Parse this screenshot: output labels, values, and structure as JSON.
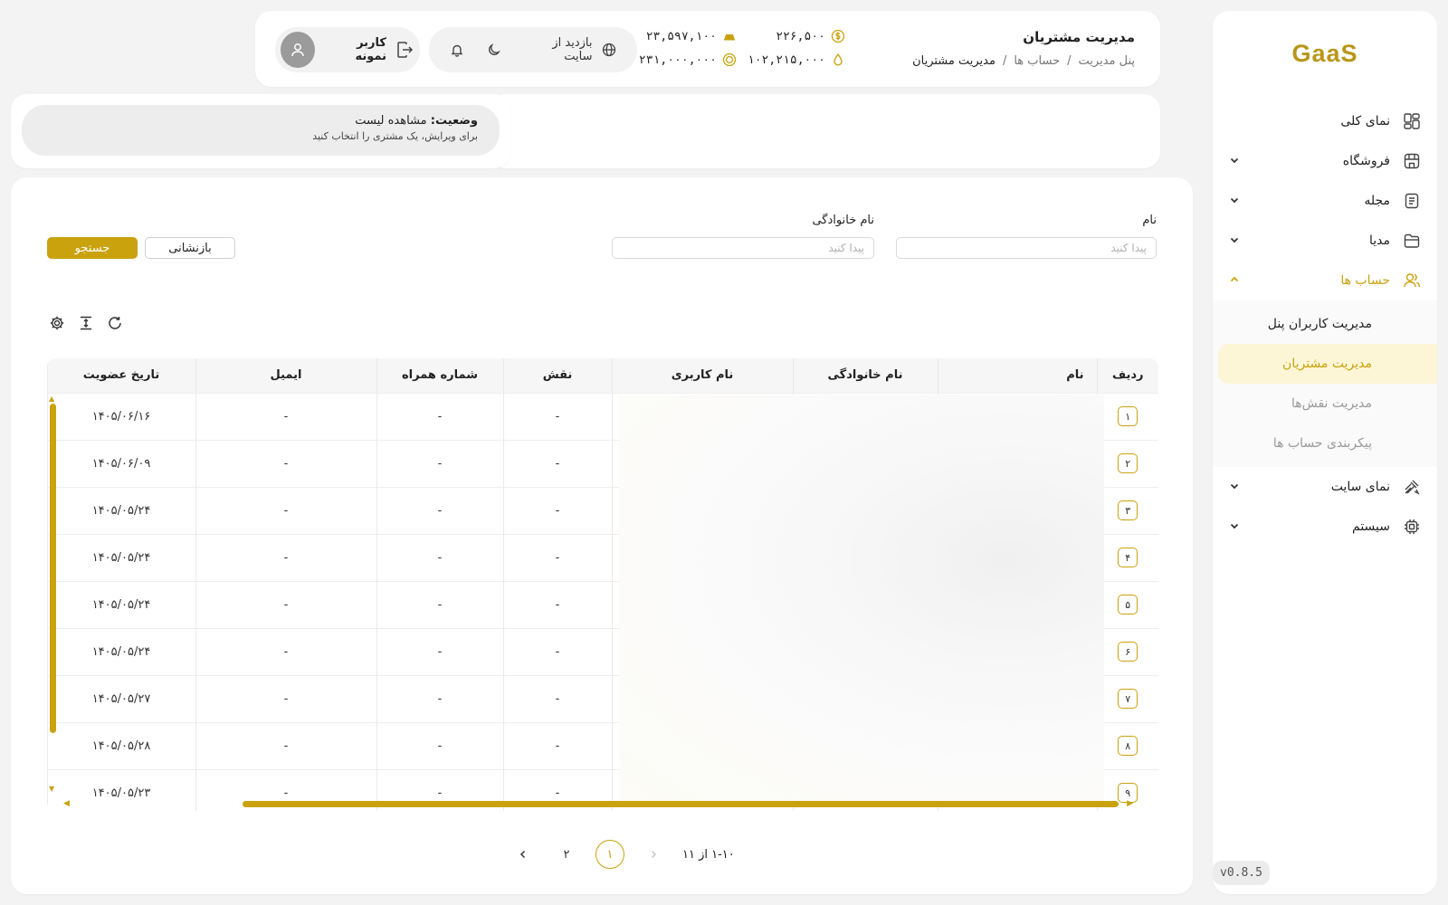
{
  "sidebar": {
    "logo": "GaaS",
    "items": [
      {
        "label": "نمای کلی",
        "icon": "dashboard-grid-icon"
      },
      {
        "label": "فروشگاه",
        "icon": "store-icon"
      },
      {
        "label": "مجله",
        "icon": "document-icon"
      },
      {
        "label": "مدیا",
        "icon": "folder-icon"
      },
      {
        "label": "حساب ها",
        "icon": "users-icon"
      }
    ],
    "submenu": [
      {
        "label": "مدیریت کاربران پنل"
      },
      {
        "label": "مدیریت مشتریان"
      },
      {
        "label": "مدیریت نقش‌ها"
      },
      {
        "label": "پیکربندی حساب ها"
      }
    ],
    "items_after": [
      {
        "label": "نمای سایت",
        "icon": "palette-icon"
      },
      {
        "label": "سیستم",
        "icon": "cpu-icon"
      }
    ],
    "version": "v0.8.5"
  },
  "header": {
    "title": "مدیریت مشتریان",
    "breadcrumb": [
      "پنل مدیریت",
      "/",
      "حساب ها",
      "/",
      "مدیریت مشتریان"
    ],
    "stats": {
      "dollar": "۲۲۶,۵۰۰",
      "gold": "۲۳,۵۹۷,۱۰۰",
      "drop": "۱۰۲,۲۱۵,۰۰۰",
      "coin": "۲۳۱,۰۰۰,۰۰۰"
    },
    "visit_site": "بازدید از سایت",
    "user_name": "کاربر نمونه"
  },
  "status": {
    "label": "وضعیت:",
    "value": "مشاهده لیست",
    "hint": "برای ویرایش، یک مشتری را انتخاب کنید"
  },
  "filters": {
    "first_name_label": "نام",
    "last_name_label": "نام خانوادگی",
    "placeholder": "پیدا کنید",
    "reset": "بازنشانی",
    "search": "جستجو"
  },
  "table": {
    "columns": [
      "ردیف",
      "نام",
      "نام خانوادگی",
      "نام کاربری",
      "نقش",
      "شماره همراه",
      "ایمیل",
      "تاریخ عضویت"
    ],
    "rows": [
      {
        "n": "۱",
        "role": "-",
        "phone": "-",
        "email": "-",
        "date": "۱۴۰۵/۰۶/۱۶"
      },
      {
        "n": "۲",
        "role": "-",
        "phone": "-",
        "email": "-",
        "date": "۱۴۰۵/۰۶/۰۹"
      },
      {
        "n": "۳",
        "role": "-",
        "phone": "-",
        "email": "-",
        "date": "۱۴۰۵/۰۵/۲۴"
      },
      {
        "n": "۴",
        "role": "-",
        "phone": "-",
        "email": "-",
        "date": "۱۴۰۵/۰۵/۲۴"
      },
      {
        "n": "۵",
        "role": "-",
        "phone": "-",
        "email": "-",
        "date": "۱۴۰۵/۰۵/۲۴"
      },
      {
        "n": "۶",
        "role": "-",
        "phone": "-",
        "email": "-",
        "date": "۱۴۰۵/۰۵/۲۴"
      },
      {
        "n": "۷",
        "role": "-",
        "phone": "-",
        "email": "-",
        "date": "۱۴۰۵/۰۵/۲۷"
      },
      {
        "n": "۸",
        "role": "-",
        "phone": "-",
        "email": "-",
        "date": "۱۴۰۵/۰۵/۲۸"
      },
      {
        "n": "۹",
        "role": "-",
        "phone": "-",
        "email": "-",
        "date": "۱۴۰۵/۰۵/۲۳"
      }
    ]
  },
  "pagination": {
    "range": "۱-۱۰ از ۱۱",
    "pages": [
      "۱",
      "۲"
    ]
  },
  "colors": {
    "accent": "#c9a20e",
    "background": "#f3f3f3",
    "card": "#ffffff"
  }
}
